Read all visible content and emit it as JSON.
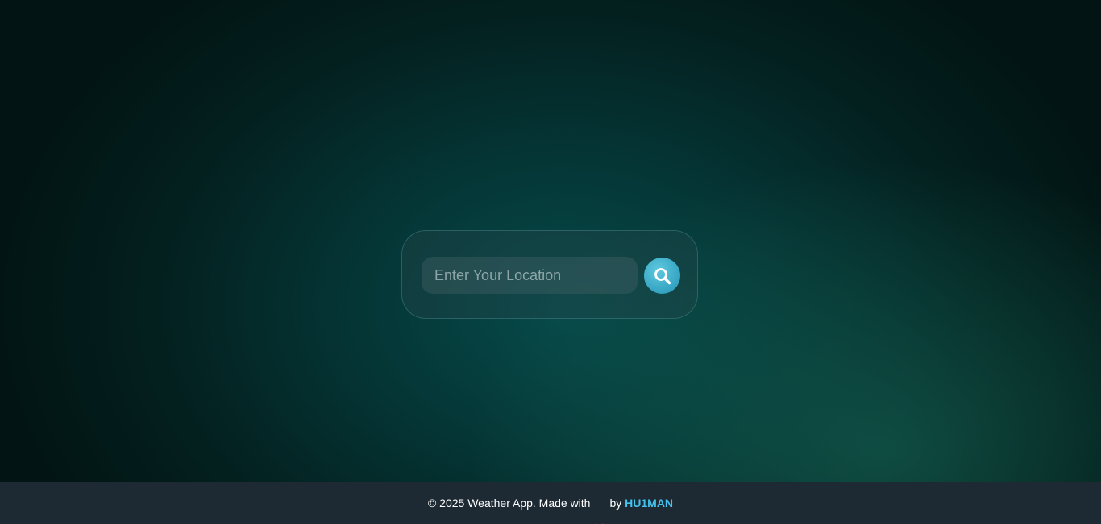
{
  "search": {
    "placeholder": "Enter Your Location",
    "value": "",
    "button_icon": "search-icon"
  },
  "footer": {
    "copyright": "© 2025 Weather App. Made with",
    "heart_icon": "heart-icon",
    "by": "by",
    "author": "HU1MAN"
  },
  "colors": {
    "accent": "#45c3ee",
    "heart": "#e5484d",
    "footer_bg": "#1d2a33",
    "search_button": "#3aa9c6"
  }
}
